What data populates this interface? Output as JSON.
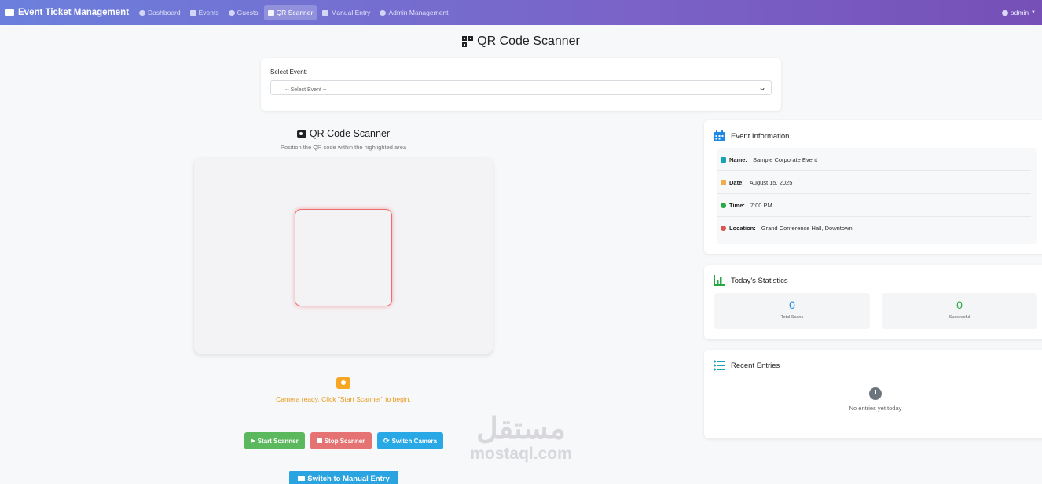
{
  "navbar": {
    "brand": "Event Ticket Management",
    "items": [
      {
        "label": "Dashboard",
        "active": false
      },
      {
        "label": "Events",
        "active": false
      },
      {
        "label": "Guests",
        "active": false
      },
      {
        "label": "QR Scanner",
        "active": true
      },
      {
        "label": "Manual Entry",
        "active": false
      },
      {
        "label": "Admin Management",
        "active": false
      }
    ],
    "user": "admin"
  },
  "page": {
    "title": "QR Code Scanner"
  },
  "event_select": {
    "label": "Select Event:",
    "value": "-- Select Event --"
  },
  "scanner": {
    "title": "QR Code Scanner",
    "subtitle": "Position the QR code within the highlighted area",
    "status": "Camera ready. Click \"Start Scanner\" to begin.",
    "buttons": {
      "start": "Start Scanner",
      "stop": "Stop Scanner",
      "switch": "Switch Camera",
      "manual": "Switch to Manual Entry"
    }
  },
  "event_info": {
    "title": "Event Information",
    "rows": [
      {
        "label": "Name:",
        "value": "Sample Corporate Event",
        "color": "#17a2b8"
      },
      {
        "label": "Date:",
        "value": "August 15, 2025",
        "color": "#f0ad4e"
      },
      {
        "label": "Time:",
        "value": "7:00 PM",
        "color": "#28a745"
      },
      {
        "label": "Location:",
        "value": "Grand Conference Hall, Downtown",
        "color": "#d9534f"
      }
    ]
  },
  "stats": {
    "title": "Today's Statistics",
    "total": {
      "value": "0",
      "label": "Total Scans",
      "color": "#1e88e5"
    },
    "successful": {
      "value": "0",
      "label": "Successful",
      "color": "#28a745"
    }
  },
  "recent": {
    "title": "Recent Entries",
    "empty": "No entries yet today"
  },
  "watermark": {
    "arabic": "مستقل",
    "latin": "mostaql.com"
  },
  "colors": {
    "accent": "#7650b6",
    "calendar": "#1e88e5",
    "chart": "#28a745",
    "list": "#17a2b8"
  }
}
